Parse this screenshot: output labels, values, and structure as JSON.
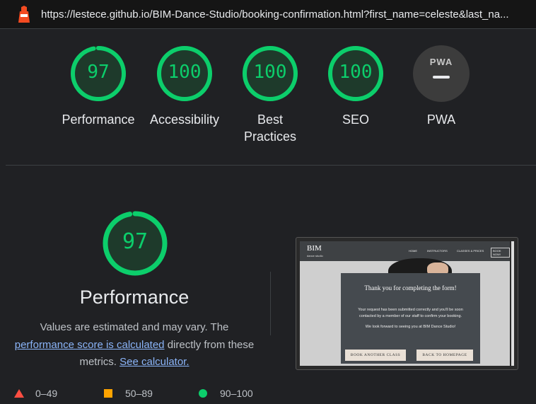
{
  "url": "https://lestece.github.io/BIM-Dance-Studio/booking-confirmation.html?first_name=celeste&last_na...",
  "categories": [
    {
      "score": "97",
      "label": "Performance",
      "fill": 0.97
    },
    {
      "score": "100",
      "label": "Accessibility",
      "fill": 1.0
    },
    {
      "score": "100",
      "label": "Best Practices",
      "fill": 1.0
    },
    {
      "score": "100",
      "label": "SEO",
      "fill": 1.0
    }
  ],
  "pwa": {
    "badge": "PWA",
    "label": "PWA"
  },
  "performance": {
    "score": "97",
    "title": "Performance",
    "desc_1": "Values are estimated and may vary. The",
    "link_1": "performance score is calculated",
    "desc_2": "directly from these metrics.",
    "link_2": "See calculator."
  },
  "legend": {
    "fail": "0–49",
    "average": "50–89",
    "pass": "90–100"
  },
  "colors": {
    "pass": "#0cce6b",
    "average": "#ffa400",
    "fail": "#ff4e42"
  },
  "screenshot": {
    "logo": "BIM",
    "logo_sub": "dance studio",
    "nav": [
      "HOME",
      "INSTRUCTORS",
      "CLASSES & PRICES"
    ],
    "nav_button": "BOOK NOW!",
    "modal_title": "Thank you for completing the form!",
    "modal_text": "Your request has been submitted correctly and you'll be soon contacted by a member of our staff to confirm your booking.",
    "modal_text_2": "We look forward to seeing you at BIM Dance Studio!",
    "button_1": "BOOK ANOTHER CLASS",
    "button_2": "BACK TO HOMEPAGE"
  }
}
